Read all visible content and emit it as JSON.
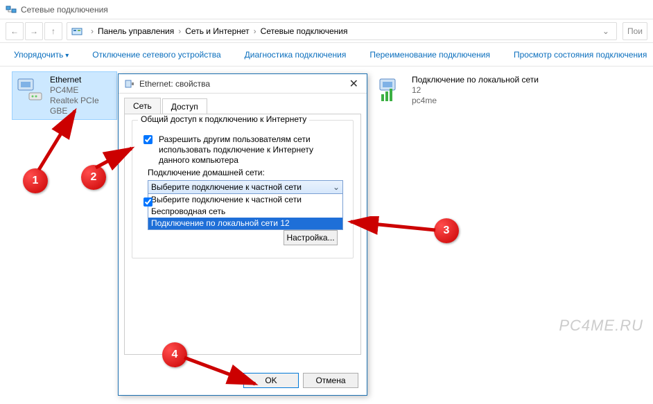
{
  "window": {
    "title": "Сетевые подключения"
  },
  "address": {
    "crumb1": "Панель управления",
    "crumb2": "Сеть и Интернет",
    "crumb3": "Сетевые подключения",
    "search_placeholder": "Пои"
  },
  "toolbar": {
    "organize": "Упорядочить",
    "disable": "Отключение сетевого устройства",
    "diag": "Диагностика подключения",
    "rename": "Переименование подключения",
    "status": "Просмотр состояния подключения"
  },
  "connections": {
    "ethernet": {
      "name": "Ethernet",
      "line2": "PC4ME",
      "line3": "Realtek PCIe GBE"
    },
    "lan": {
      "name": "Подключение по локальной сети",
      "line2": "12",
      "line3": "pc4me"
    }
  },
  "dialog": {
    "title": "Ethernet: свойства",
    "tab_network": "Сеть",
    "tab_access": "Доступ",
    "group_title": "Общий доступ к подключению к Интернету",
    "check_allow": "Разрешить другим пользователям сети использовать подключение к Интернету данного компьютера",
    "home_label": "Подключение домашней сети:",
    "combo_selected": "Выберите подключение к частной сети",
    "combo_opt1": "Выберите подключение к частной сети",
    "combo_opt2": "Беспроводная сеть",
    "combo_opt3": "Подключение по локальной сети 12",
    "settings_btn": "Настройка...",
    "ok": "OK",
    "cancel": "Отмена"
  },
  "annotations": {
    "b1": "1",
    "b2": "2",
    "b3": "3",
    "b4": "4"
  },
  "watermark": "PC4ME.RU"
}
